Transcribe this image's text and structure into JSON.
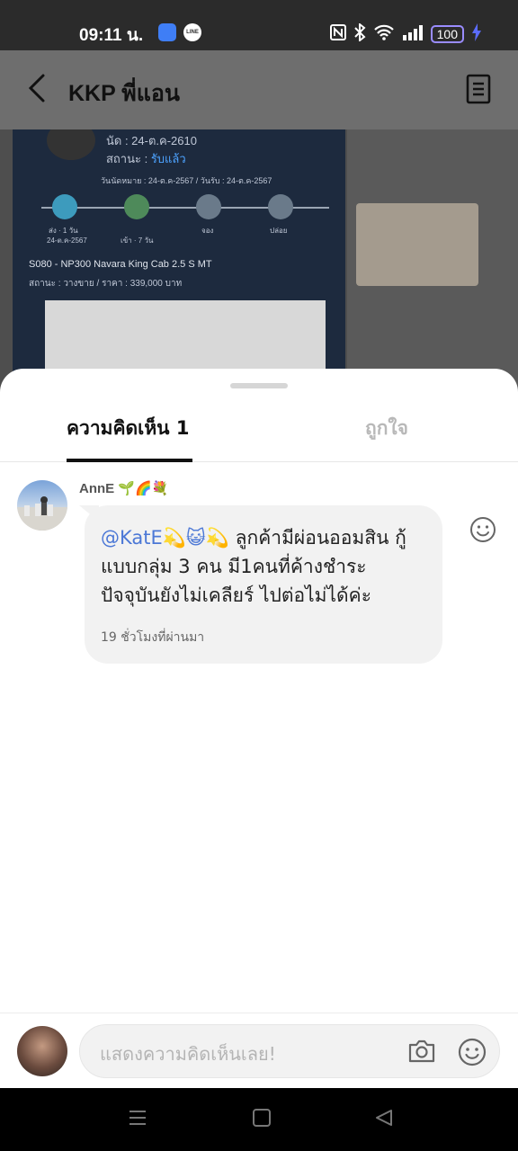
{
  "status_bar": {
    "time": "09:11 น.",
    "battery": "100",
    "app_icon_2_text": "LINE"
  },
  "header": {
    "title": "KKP พี่แอน"
  },
  "background_post": {
    "line1": "นัด : 24-ต.ค-2610",
    "line2_prefix": "สถานะ : ",
    "line2_status": "รับแล้ว",
    "line3": "วันนัดหมาย : 24-ต.ค-2567 / วันรับ : 24-ต.ค-2567",
    "step_labels": [
      "ส่ง · 1 วัน",
      "เข้า · 7 วัน",
      "จอง",
      "ปล่อย"
    ],
    "step1_sublabel": "24-ต.ค-2567",
    "car_model": "S080 - NP300 Navara King Cab 2.5 S MT",
    "car_status": "สถานะ : วางขาย / ราคา : 339,000 บาท"
  },
  "sheet": {
    "tabs": [
      {
        "label": "ความคิดเห็น 1",
        "active": true
      },
      {
        "label": "ถูกใจ",
        "active": false
      }
    ],
    "comment": {
      "author": "AnnE 🌱🌈💐",
      "mention": "@KatE💫😺💫",
      "text": " ลูกค้ามีผ่อนออมสิน กู้แบบกลุ่ม 3 คน มี1คนที่ค้างชำระ ปัจจุบันยังไม่เคลียร์ ไปต่อไม่ได้ค่ะ",
      "time": "19 ชั่วโมงที่ผ่านมา"
    },
    "input": {
      "placeholder": "แสดงความคิดเห็นเลย!"
    }
  },
  "icons": {
    "back": "back-arrow-icon",
    "menu": "document-menu-icon",
    "react": "smiley-icon",
    "camera": "camera-icon",
    "emoji": "emoji-icon",
    "nav": [
      "recent-apps-icon",
      "home-icon",
      "back-triangle-icon"
    ]
  },
  "colors": {
    "mention": "#4c78d6",
    "overlay": "#6e6e6e"
  }
}
